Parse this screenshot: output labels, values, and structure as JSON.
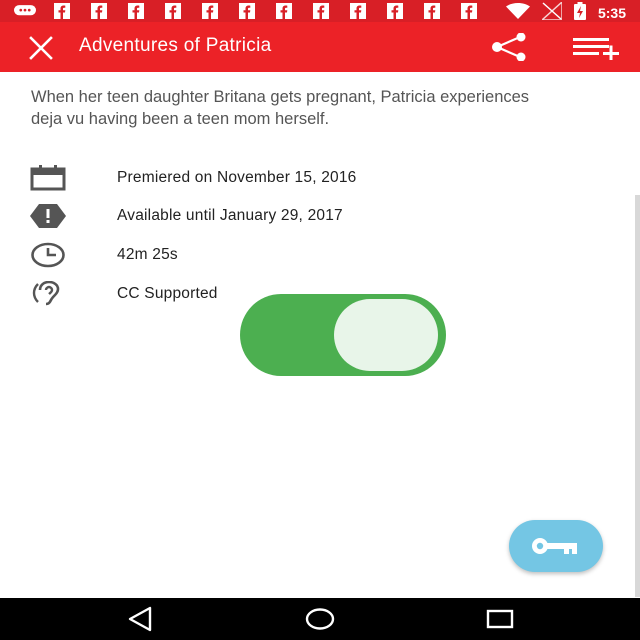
{
  "status_bar": {
    "time": "5:35",
    "notification_icons": [
      "message-icon",
      "facebook-icon",
      "facebook-icon",
      "facebook-icon",
      "facebook-icon",
      "facebook-icon",
      "facebook-icon",
      "facebook-icon",
      "facebook-icon",
      "facebook-icon",
      "facebook-icon",
      "facebook-icon"
    ],
    "system_icons": [
      "wifi-icon",
      "no-signal-icon",
      "battery-charging-icon"
    ]
  },
  "app_bar": {
    "title": "Adventures of Patricia",
    "close_icon": "close-icon",
    "share_icon": "share-icon",
    "queue_icon": "add-to-queue-icon",
    "color": "#ec2227"
  },
  "description": "When her teen daughter Britana gets pregnant, Patricia experiences deja vu having been a teen mom herself.",
  "details": [
    {
      "icon": "calendar-icon",
      "text": "Premiered on November 15, 2016"
    },
    {
      "icon": "alert-icon",
      "text": "Available until January 29, 2017"
    },
    {
      "icon": "clock-icon",
      "text": "42m 25s"
    },
    {
      "icon": "hearing-icon",
      "text": "CC Supported"
    }
  ],
  "cc_toggle": {
    "state": "on",
    "color": "#4caf50"
  },
  "fab": {
    "icon": "key-icon",
    "color": "#74c6e4"
  },
  "nav_bar": {
    "icons": [
      "back-icon",
      "home-icon",
      "recents-icon"
    ]
  }
}
